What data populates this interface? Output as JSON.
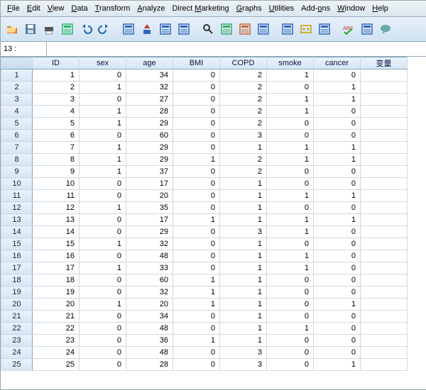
{
  "menu": {
    "items": [
      {
        "u": "F",
        "text": "ile"
      },
      {
        "u": "E",
        "text": "dit"
      },
      {
        "u": "V",
        "text": "iew"
      },
      {
        "u": "D",
        "text": "ata"
      },
      {
        "u": "T",
        "text": "ransform"
      },
      {
        "u": "A",
        "text": "nalyze"
      },
      {
        "u": "",
        "text": "Direct ",
        "u2": "M",
        "text2": "arketing"
      },
      {
        "u": "G",
        "text": "raphs"
      },
      {
        "u": "U",
        "text": "tilities"
      },
      {
        "u": "",
        "text": "Add-",
        "u2": "o",
        "text2": "ns"
      },
      {
        "u": "W",
        "text": "indow"
      },
      {
        "u": "H",
        "text": "elp"
      }
    ]
  },
  "toolbar": {
    "buttons": [
      "open-icon",
      "save-icon",
      "print-icon",
      "preview-icon",
      "undo-icon",
      "redo-icon",
      "",
      "goto-case-icon",
      "sort-asc-icon",
      "variables-icon",
      "compute-icon",
      "",
      "find-icon",
      "insert-case-icon",
      "split-file-icon",
      "weight-icon",
      "",
      "select-cases-icon",
      "value-labels-icon",
      "use-sets-icon",
      "",
      "spellcheck-abc-icon",
      "customize-icon",
      "help-balloon-icon"
    ]
  },
  "name_box": {
    "reference": "13 :",
    "formula": ""
  },
  "columns": [
    "ID",
    "sex",
    "age",
    "BMI",
    "COPD",
    "smoke",
    "cancer",
    "变量"
  ],
  "rows": [
    [
      1,
      0,
      34,
      0,
      2,
      1,
      0
    ],
    [
      2,
      1,
      32,
      0,
      2,
      0,
      1
    ],
    [
      3,
      0,
      27,
      0,
      2,
      1,
      1
    ],
    [
      4,
      1,
      28,
      0,
      2,
      1,
      0
    ],
    [
      5,
      1,
      29,
      0,
      2,
      0,
      0
    ],
    [
      6,
      0,
      60,
      0,
      3,
      0,
      0
    ],
    [
      7,
      1,
      29,
      0,
      1,
      1,
      1
    ],
    [
      8,
      1,
      29,
      1,
      2,
      1,
      1
    ],
    [
      9,
      1,
      37,
      0,
      2,
      0,
      0
    ],
    [
      10,
      0,
      17,
      0,
      1,
      0,
      0
    ],
    [
      11,
      0,
      20,
      0,
      1,
      1,
      1
    ],
    [
      12,
      1,
      35,
      0,
      1,
      0,
      0
    ],
    [
      13,
      0,
      17,
      1,
      1,
      1,
      1
    ],
    [
      14,
      0,
      29,
      0,
      3,
      1,
      0
    ],
    [
      15,
      1,
      32,
      0,
      1,
      0,
      0
    ],
    [
      16,
      0,
      48,
      0,
      1,
      1,
      0
    ],
    [
      17,
      1,
      33,
      0,
      1,
      1,
      0
    ],
    [
      18,
      0,
      60,
      1,
      1,
      0,
      0
    ],
    [
      19,
      0,
      32,
      1,
      1,
      0,
      0
    ],
    [
      20,
      1,
      20,
      1,
      1,
      0,
      1
    ],
    [
      21,
      0,
      34,
      0,
      1,
      0,
      0
    ],
    [
      22,
      0,
      48,
      0,
      1,
      1,
      0
    ],
    [
      23,
      0,
      36,
      1,
      1,
      0,
      0
    ],
    [
      24,
      0,
      48,
      0,
      3,
      0,
      0
    ],
    [
      25,
      0,
      28,
      0,
      3,
      0,
      1
    ]
  ],
  "icons": {
    "open-icon": "#d97a1e",
    "save-icon": "#5b7a99",
    "print-icon": "#555",
    "preview-icon": "#2b6",
    "undo-icon": "#26a",
    "redo-icon": "#26a",
    "goto-case-icon": "#36b",
    "sort-asc-icon": "#c33",
    "variables-icon": "#36b",
    "compute-icon": "#36b",
    "find-icon": "#333",
    "insert-case-icon": "#3a6",
    "split-file-icon": "#c63",
    "weight-icon": "#36b",
    "select-cases-icon": "#36b",
    "value-labels-icon": "#c90",
    "use-sets-icon": "#36b",
    "spellcheck-abc-icon": "#c33",
    "customize-icon": "#36b",
    "help-balloon-icon": "#6aa"
  }
}
